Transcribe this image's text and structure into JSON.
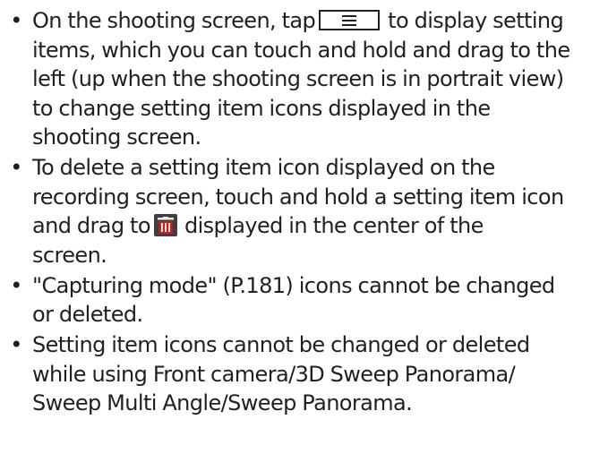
{
  "bullets": [
    {
      "marker": "•",
      "lines": [
        {
          "before": "On the shooting screen, tap",
          "after": "to display setting"
        },
        "items, which you can touch and hold and drag to the",
        "left (up when the shooting screen is in portrait view)",
        "to change setting item icons displayed in the",
        "shooting screen."
      ]
    },
    {
      "marker": "•",
      "lines": [
        "To delete a setting item icon displayed on the",
        "recording screen, touch and hold a setting item icon",
        {
          "before": "and drag to",
          "after": "displayed in the center of the"
        },
        "screen."
      ]
    },
    {
      "marker": "•",
      "lines": [
        "\"Capturing mode\" (P.181) icons cannot be changed",
        "or deleted."
      ]
    },
    {
      "marker": "•",
      "lines": [
        "Setting item icons cannot be changed or deleted",
        "while using Front camera/3D Sweep Panorama/",
        "Sweep Multi Angle/Sweep Panorama."
      ]
    }
  ],
  "icons": {
    "menu_button": "menu-icon",
    "trash_can": "trash-can-icon"
  },
  "colors": {
    "text": "#231f20",
    "trash_background": "#3f3f3f",
    "trash_glyph": "#c81e1e"
  }
}
